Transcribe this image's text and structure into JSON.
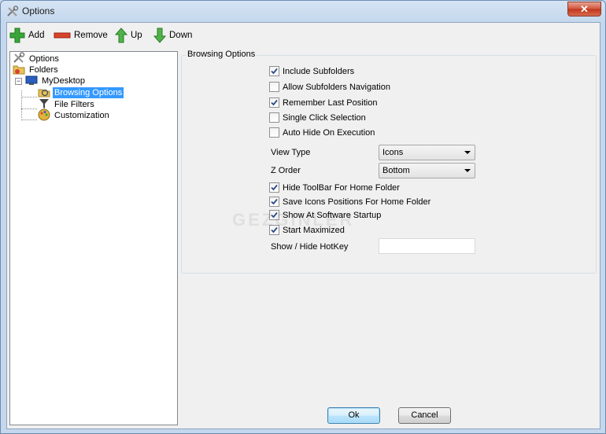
{
  "window": {
    "title": "Options",
    "close_glyph": "✕"
  },
  "toolbar": {
    "add_label": "Add",
    "remove_label": "Remove",
    "up_label": "Up",
    "down_label": "Down",
    "colors": {
      "add": "#3aa53a",
      "remove": "#d9432c",
      "up": "#4fb34a",
      "down": "#4fb34a"
    }
  },
  "tree": {
    "items": [
      {
        "label": "Options",
        "icon": "tools-icon"
      },
      {
        "label": "Folders",
        "icon": "folders-icon"
      },
      {
        "label": "MyDesktop",
        "icon": "desktop-icon",
        "expanded": true
      },
      {
        "label": "Browsing Options",
        "icon": "browse-icon",
        "selected": true
      },
      {
        "label": "File Filters",
        "icon": "filter-icon"
      },
      {
        "label": "Customization",
        "icon": "palette-icon"
      }
    ]
  },
  "browsing": {
    "group_title": "Browsing Options",
    "include_subfolders": {
      "label": "Include Subfolders",
      "checked": true
    },
    "allow_subfolders_nav": {
      "label": "Allow Subfolders Navigation",
      "checked": false
    },
    "remember_last_position": {
      "label": "Remember Last Position",
      "checked": true
    },
    "single_click": {
      "label": "Single Click Selection",
      "checked": false
    },
    "auto_hide": {
      "label": "Auto Hide On Execution",
      "checked": false
    },
    "view_type": {
      "label": "View Type",
      "value": "Icons"
    },
    "z_order": {
      "label": "Z Order",
      "value": "Bottom"
    },
    "hide_toolbar": {
      "label": "Hide ToolBar For Home Folder",
      "checked": true
    },
    "save_icon_positions": {
      "label": "Save Icons Positions For Home Folder",
      "checked": true
    },
    "show_at_startup": {
      "label": "Show At Software Startup",
      "checked": true
    },
    "start_maximized": {
      "label": "Start Maximized",
      "checked": true
    },
    "hotkey": {
      "label": "Show / Hide HotKey",
      "value": ""
    }
  },
  "watermark": "GEZGINLER",
  "footer": {
    "ok_label": "Ok",
    "cancel_label": "Cancel"
  }
}
